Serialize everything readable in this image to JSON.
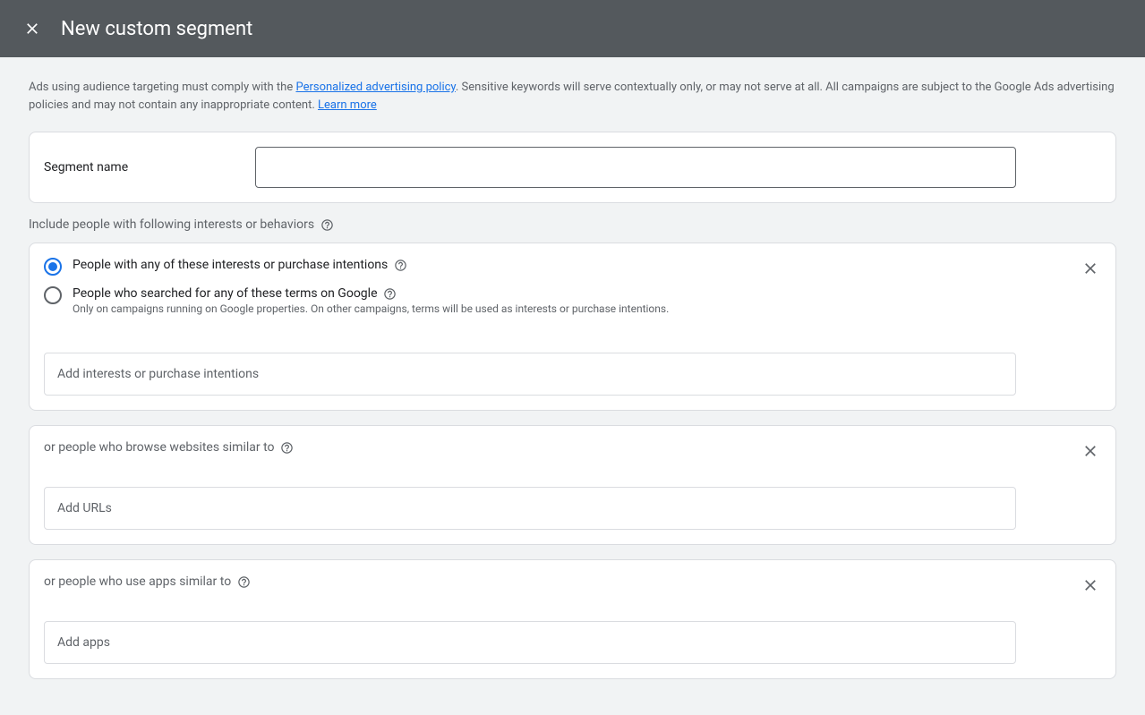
{
  "header": {
    "title": "New custom segment"
  },
  "notice": {
    "prefix": "Ads using audience targeting must comply with the ",
    "policy_link": "Personalized advertising policy",
    "middle": ". Sensitive keywords will serve contextually only, or may not serve at all. All campaigns are subject to the Google Ads advertising policies and may not contain any inappropriate content. ",
    "learn_more": "Learn more"
  },
  "segment_name": {
    "label": "Segment name",
    "value": ""
  },
  "section_intro": "Include people with following interests or behaviors",
  "interests_card": {
    "radio1_label": "People with any of these interests or purchase intentions",
    "radio2_label": "People who searched for any of these terms on Google",
    "radio2_sublabel": "Only on campaigns running on Google properties. On other campaigns, terms will be used as interests or purchase intentions.",
    "input_placeholder": "Add interests or purchase intentions"
  },
  "websites_card": {
    "label": "or people who browse websites similar to",
    "input_placeholder": "Add URLs"
  },
  "apps_card": {
    "label": "or people who use apps similar to",
    "input_placeholder": "Add apps"
  }
}
